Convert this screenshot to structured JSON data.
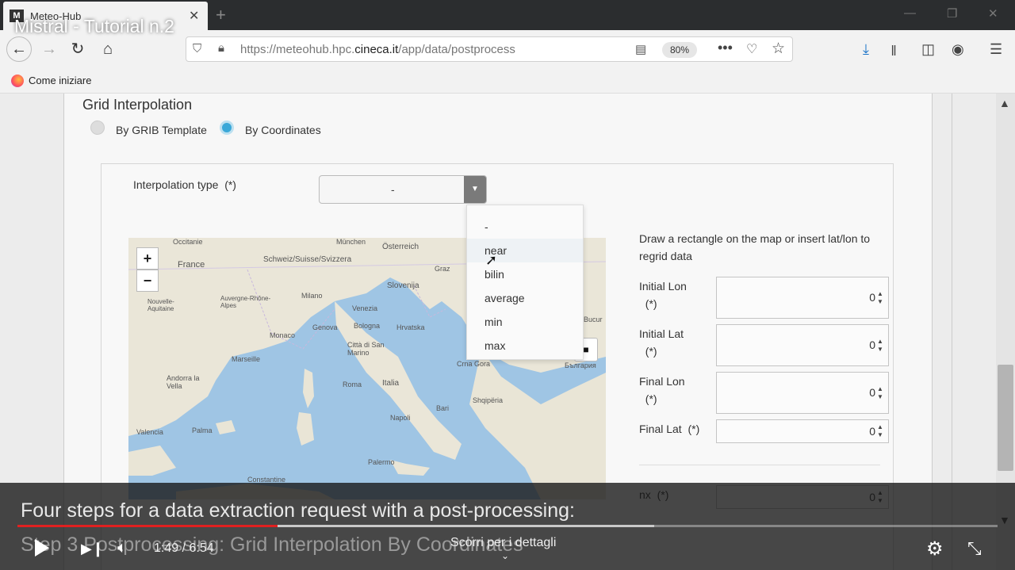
{
  "video": {
    "title": "Mistral - Tutorial n.2",
    "subtitle_line1": "Four steps for a data extraction request with a post-processing:",
    "subtitle_line2": "Step 3 Postprocessing: Grid Interpolation By Coordinates",
    "time": "1:49 / 6:54",
    "scroll_hint": "Scorri per i dettagli",
    "played_fraction": 0.265,
    "buffered_fraction": 0.65
  },
  "browser": {
    "tab_title": "Meteo-Hub",
    "url_prefix": "https://meteohub.hpc.",
    "url_domain": "cineca.it",
    "url_path": "/app/data/postprocess",
    "zoom": "80%",
    "bookmark": "Come iniziare"
  },
  "page": {
    "section_title": "Grid Interpolation",
    "radio_options": [
      {
        "label": "By GRIB Template",
        "selected": false
      },
      {
        "label": "By Coordinates",
        "selected": true
      }
    ],
    "interpolation_label": "Interpolation type",
    "required_mark": "(*)",
    "interpolation_selected": "-",
    "dropdown_options": [
      "-",
      "near",
      "bilin",
      "average",
      "min",
      "max"
    ],
    "hovered_option": "near",
    "coord_help": "Draw a rectangle on the map or insert lat/lon to regrid data",
    "fields": [
      {
        "label": "Initial Lon",
        "value": "0"
      },
      {
        "label": "Initial Lat",
        "value": "0"
      },
      {
        "label": "Final Lon",
        "value": "0"
      },
      {
        "label": "Final Lat",
        "value": "0"
      }
    ],
    "nx_label": "nx",
    "nx_value": "0",
    "map": {
      "zoom_in": "+",
      "zoom_out": "−",
      "labels": [
        "France",
        "Schweiz/Suisse/Svizzera",
        "Österreich",
        "München",
        "Graz",
        "Slovenija",
        "Milano",
        "Venezia",
        "Genova",
        "Bologna",
        "Hrvatska",
        "Monaco",
        "Marseille",
        "Città di San Marino",
        "Andorra la Vella",
        "Italia",
        "Roma",
        "Bari",
        "Napoli",
        "Palma",
        "Valencia",
        "Palermo",
        "Shqipëria",
        "Crna Gora",
        "България",
        "Bucur",
        "Constantine",
        "Occitanie",
        "Auvergne-Rhône-Alpes",
        "Nouvelle-Aquitaine"
      ]
    }
  }
}
